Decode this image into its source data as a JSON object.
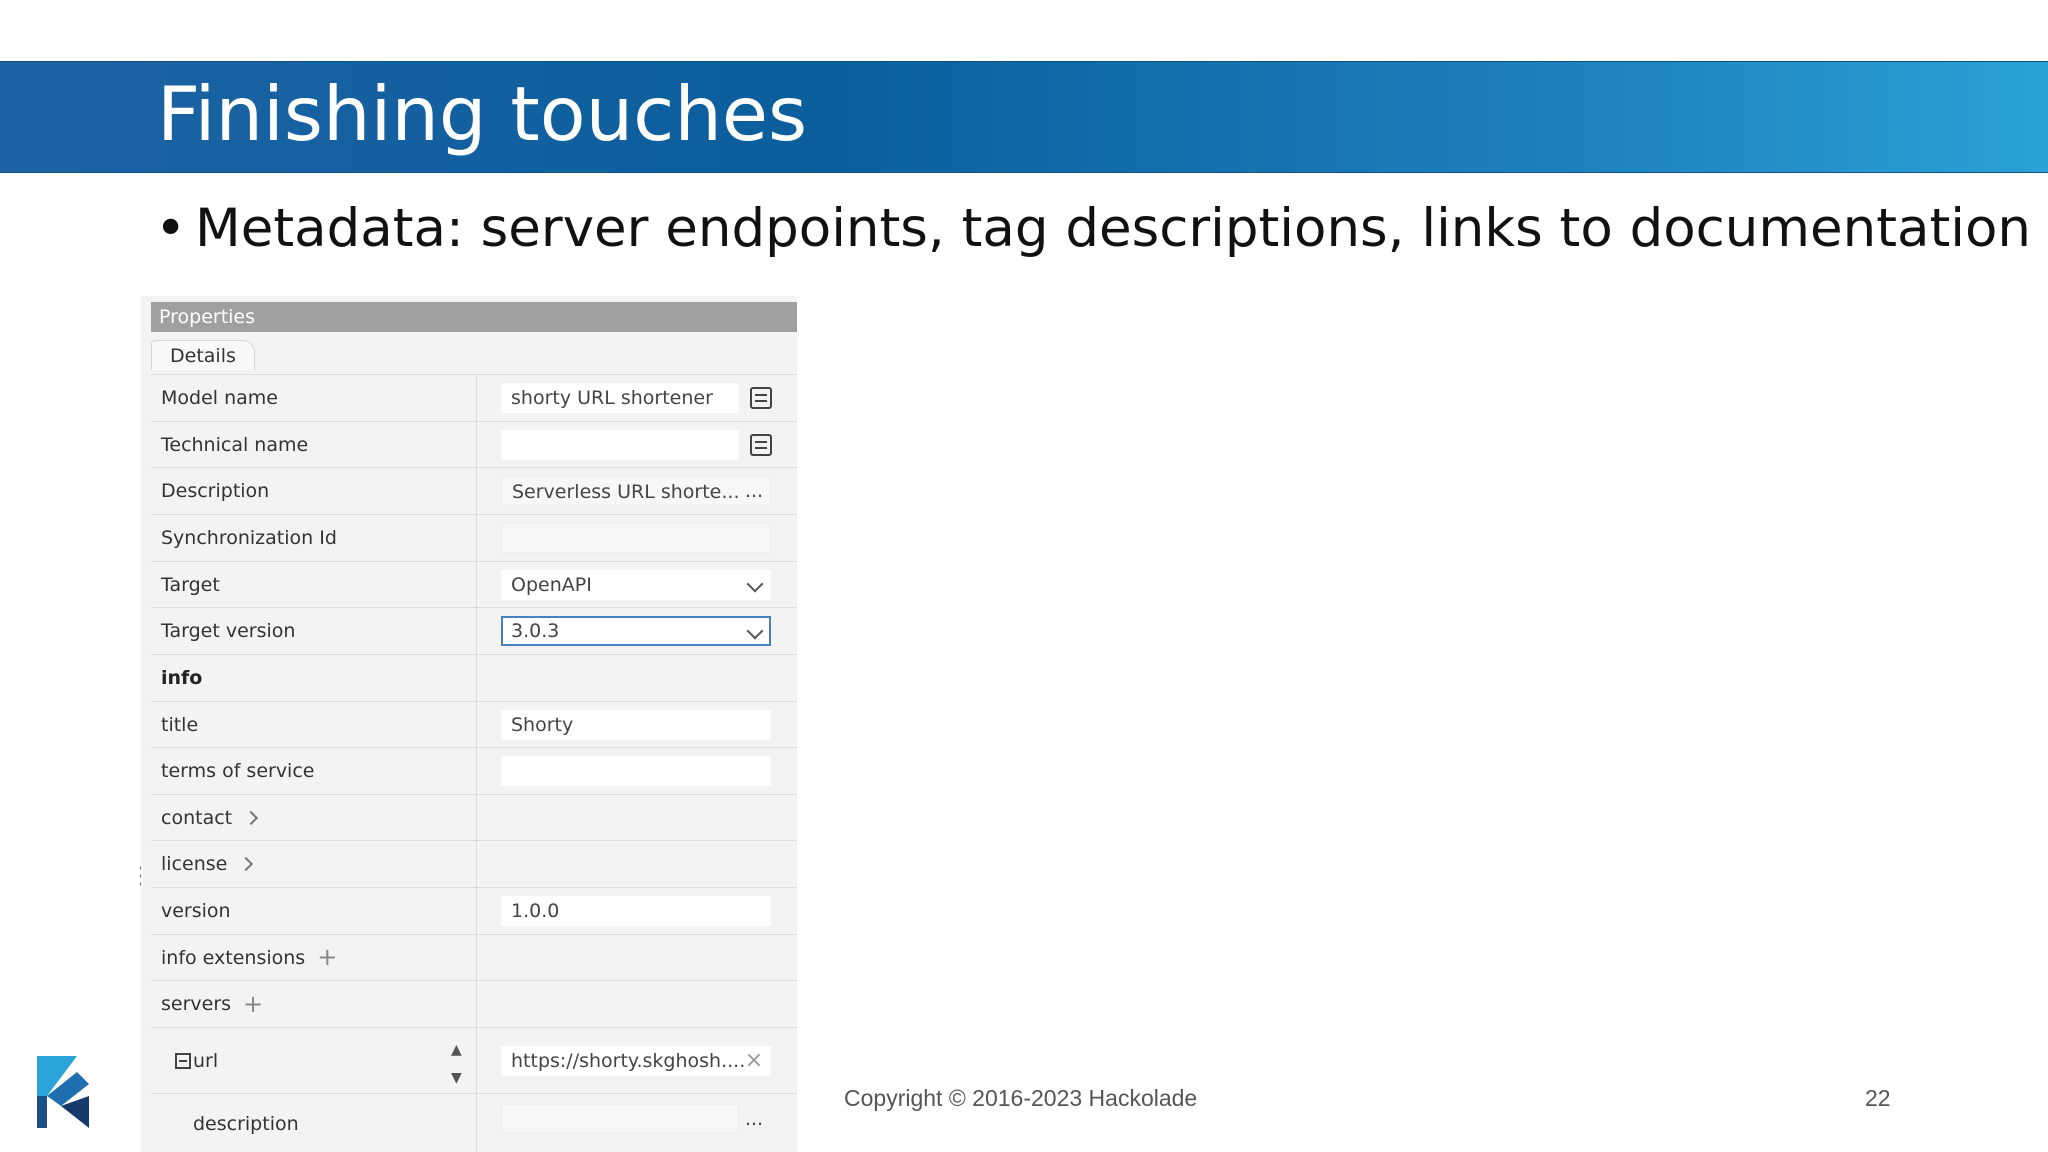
{
  "slide": {
    "title": "Finishing touches",
    "bullet": "Metadata: server endpoints, tag descriptions, links to documentation",
    "copyright": "Copyright © 2016-2023 Hackolade",
    "page_number": "22"
  },
  "panel": {
    "header": "Properties",
    "tab": "Details",
    "rows": {
      "model_name": {
        "label": "Model name",
        "value": "shorty URL shortener"
      },
      "technical_name": {
        "label": "Technical name",
        "value": ""
      },
      "description": {
        "label": "Description",
        "value": "Serverless URL shorte..."
      },
      "sync_id": {
        "label": "Synchronization Id",
        "value": ""
      },
      "target": {
        "label": "Target",
        "value": "OpenAPI"
      },
      "target_version": {
        "label": "Target version",
        "value": "3.0.3"
      },
      "info": {
        "label": "info"
      },
      "title": {
        "label": "title",
        "value": "Shorty"
      },
      "terms": {
        "label": "terms of service",
        "value": ""
      },
      "contact": {
        "label": "contact"
      },
      "license": {
        "label": "license"
      },
      "version": {
        "label": "version",
        "value": "1.0.0"
      },
      "info_ext": {
        "label": "info extensions"
      },
      "servers": {
        "label": "servers"
      },
      "url": {
        "label": "url",
        "value": "https://shorty.skghosh...."
      },
      "server_description": {
        "label": "description",
        "value": ""
      }
    },
    "ellipsis": "...",
    "clear": "×"
  },
  "icons": {
    "list": "list-icon",
    "dropdown": "chevron-down-icon",
    "expand": "chevron-right-icon",
    "add": "plus-icon",
    "collapse": "minus-box-icon",
    "sort": "sort-arrows-icon",
    "logo": "hackolade-logo"
  },
  "colors": {
    "title_bar": "#1d63a4",
    "title_bar_light": "#2ba2d4",
    "panel_header": "#a0a0a0",
    "focus_border": "#4a7fc1"
  }
}
